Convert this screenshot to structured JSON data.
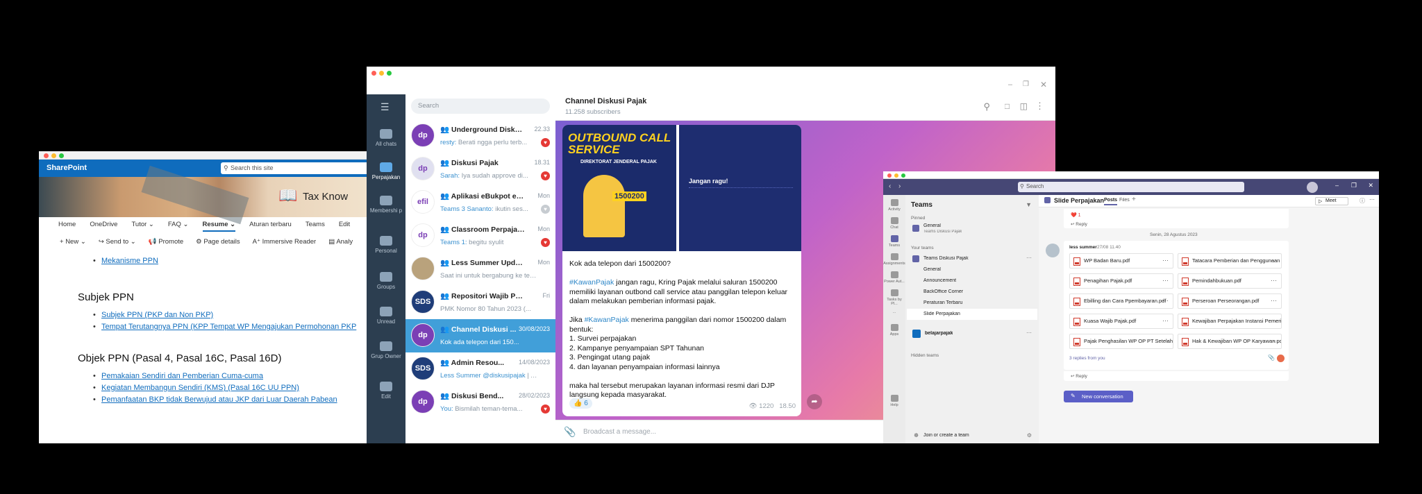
{
  "sharepoint": {
    "brand": "SharePoint",
    "search_placeholder": "Search this site",
    "banner_title": "Tax Know",
    "nav": [
      "Home",
      "OneDrive",
      "Tutor",
      "FAQ",
      "Resume",
      "Aturan terbaru",
      "Teams",
      "Edit"
    ],
    "commands": [
      "New",
      "Send to",
      "Promote",
      "Page details",
      "Immersive Reader",
      "Analy"
    ],
    "link_top": "Mekanisme PPN",
    "h_subjek": "Subjek PPN",
    "subjek_items": [
      "Subjek PPN (PKP dan Non PKP)",
      "Tempat Terutangnya PPN (KPP Tempat WP Mengajukan Permohonan PKP"
    ],
    "h_objek": "Objek PPN (Pasal 4, Pasal 16C, Pasal 16D)",
    "objek_items": [
      "Pemakaian Sendiri dan Pemberian Cuma-cuma",
      "Kegiatan Membangun Sendiri (KMS) (Pasal 16C UU PPN)",
      "Pemanfaatan BKP tidak Berwujud atau JKP dari Luar Daerah Pabean"
    ]
  },
  "telegram": {
    "rail": [
      {
        "label": "All chats"
      },
      {
        "label": "Perpajakan"
      },
      {
        "label": "Membershi p"
      },
      {
        "label": "Personal"
      },
      {
        "label": "Groups"
      },
      {
        "label": "Unread"
      },
      {
        "label": "Grup Owner"
      },
      {
        "label": "Edit"
      }
    ],
    "search_placeholder": "Search",
    "chats": [
      {
        "name": "Underground Diskusi ...",
        "time": "22.33",
        "who": "resty:",
        "preview": " Berati ngga perlu terb...",
        "badge": "♥",
        "avatar": "dp",
        "color": "#7b3fb5"
      },
      {
        "name": "Diskusi Pajak",
        "time": "18.31",
        "who": "Sarah:",
        "preview": " Iya sudah approve di...",
        "badge": "♥",
        "avatar": "dp",
        "color": "#e0e0f0"
      },
      {
        "name": "Aplikasi eBukpot eFakt...",
        "time": "Mon",
        "who": "Teams 3 Sananto:",
        "preview": " ikutin ses...",
        "badge": "♥",
        "avatar": "efil",
        "color": "#fff"
      },
      {
        "name": "Classroom Perpajakan",
        "time": "Mon",
        "who": "Teams 1:",
        "preview": " begitu syulit",
        "badge": "♥",
        "avatar": "dp",
        "color": "#fff"
      },
      {
        "name": "Less Summer Updat...",
        "time": "Mon",
        "who": "",
        "preview": "Saat ini untuk bergabung ke tea...",
        "badge": "",
        "avatar": "",
        "color": "#b9a27c"
      },
      {
        "name": "Repositori Wajib Pajak",
        "time": "Fri",
        "who": "",
        "preview": "PMK Nomor 80 Tahun 2023 (...",
        "badge": "",
        "avatar": "SDS",
        "color": "#1f3d79"
      },
      {
        "name": "Channel Diskusi ...",
        "time": "30/08/2023",
        "who": "",
        "preview": "Kok ada telepon dari 150...",
        "badge": "",
        "avatar": "dp",
        "color": "#7b3fb5"
      },
      {
        "name": "Admin Resou...",
        "time": "14/08/2023",
        "who": "Less Summer @diskusipajak",
        "preview": " | A...",
        "badge": "",
        "avatar": "SDS",
        "color": "#1f3d79"
      },
      {
        "name": "Diskusi Bend...",
        "time": "28/02/2023",
        "who": "You:",
        "preview": " Bismilah teman-tema...",
        "badge": "♥",
        "avatar": "dp",
        "color": "#7b3fb5"
      }
    ],
    "channel_title": "Channel Diskusi Pajak",
    "subscribers": "11.258 subscribers",
    "poster_title": "OUTBOUND CALL SERVICE",
    "poster_sub": "DIREKTORAT JENDERAL PAJAK",
    "poster_number": "1500200",
    "poster2_heading": "Jangan ragu!",
    "message_lines": [
      "Kok ada telepon dari 1500200?",
      "",
      "#KawanPajak jangan ragu, Kring Pajak melalui saluran 1500200 memiliki layanan outbond call service atau panggilan telepon keluar dalam melakukan pemberian informasi pajak.",
      "",
      "Jika #KawanPajak menerima panggilan dari nomor 1500200 dalam bentuk:",
      "1. Survei perpajakan",
      "2. Kampanye penyampaian SPT Tahunan",
      "3. Pengingat utang pajak",
      "4. dan layanan penyampaian informasi lainnya",
      "",
      "maka hal tersebut merupakan layanan informasi resmi dari DJP langsung kepada masyarakat."
    ],
    "reaction": "👍 6",
    "views": "1220",
    "post_time": "18.50",
    "compose_placeholder": "Broadcast a message..."
  },
  "teams": {
    "search_placeholder": "Search",
    "rail": [
      "Activity",
      "Chat",
      "Teams",
      "Assignments",
      "Power Aut...",
      "Tasks by Pl...",
      "...",
      "Apps",
      "Help"
    ],
    "pane_title": "Teams",
    "pinned_label": "Pinned",
    "pinned_team": "General",
    "pinned_team_sub": "Teams Diskusi Pajak",
    "your_teams_label": "Your teams",
    "team_name": "Teams Diskusi Pajak",
    "channels": [
      "General",
      "Announcement",
      "BackOffice Corner",
      "Peraturan Terbaru",
      "Slide Perpajakan"
    ],
    "team2": "belajarpajak",
    "hidden_teams": "Hidden teams",
    "join_label": "Join or create a team",
    "channel_title": "Slide Perpajakan",
    "tabs": [
      "Posts",
      "Files"
    ],
    "meet_label": "Meet",
    "reply_label": "Reply",
    "heart_count": "1",
    "date_divider": "Senin, 28 Agustus 2023",
    "author": "less summer",
    "post_time": "27/08 11.40",
    "files": [
      "WP Badan Baru.pdf",
      "Tatacara Pemberian dan Penggunaan N...",
      "Penagihan Pajak.pdf",
      "Pemindahbukuan.pdf",
      "Ebilling dan Cara Ppembayaran.pdf",
      "Perseroan Perseorangan.pdf",
      "Kuasa Wajib Pajak.pdf",
      "Kewajiban Perpajakan Instansi Pemerint...",
      "Pajak Penghasilan WP OP PT Setelah PP...",
      "Hak & Kewajiban WP OP Karyawan.pdf"
    ],
    "replies_from": "3 replies from you",
    "new_conversation": "New conversation"
  }
}
